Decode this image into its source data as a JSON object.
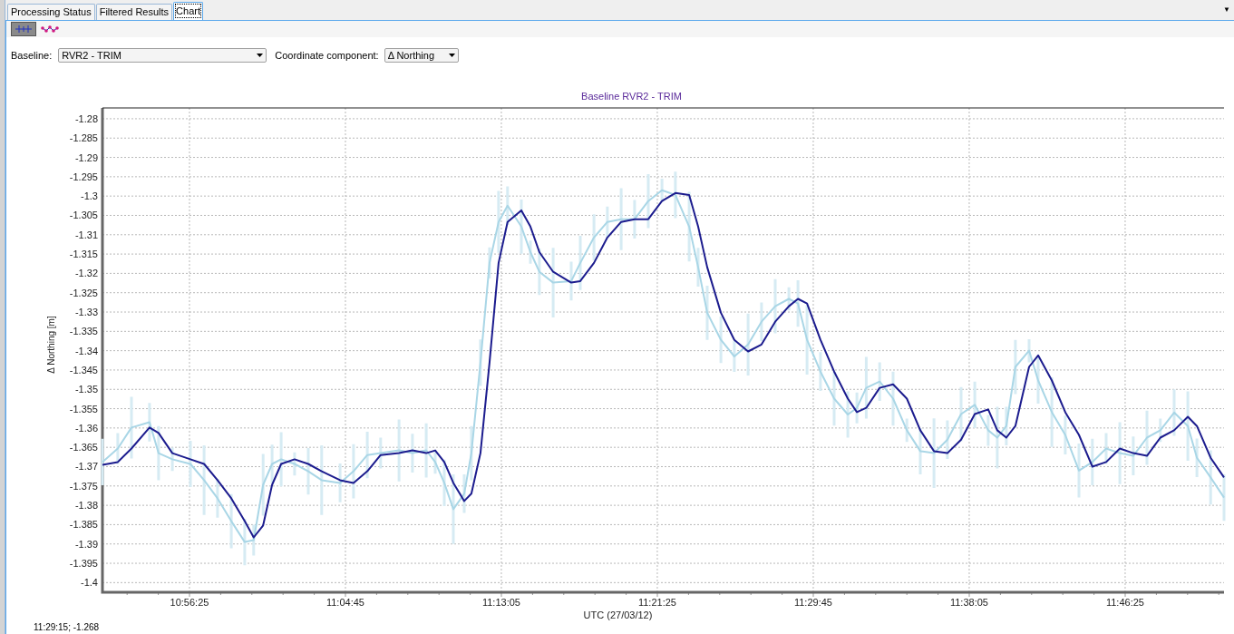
{
  "tabs": [
    {
      "label": "Processing Status",
      "selected": false
    },
    {
      "label": "Filtered Results",
      "selected": false
    },
    {
      "label": "Chart",
      "selected": true
    }
  ],
  "tab_menu": {
    "label": "▼"
  },
  "toolbar": [
    {
      "kind": "error-bars",
      "selected": true
    },
    {
      "kind": "points",
      "selected": false
    }
  ],
  "baseline": {
    "label": "Baseline:",
    "value": "RVR2 - TRIM"
  },
  "component": {
    "label": "Coordinate component:",
    "value": "Δ Northing"
  },
  "chart": {
    "chart_data": {
      "type": "line",
      "title": "Baseline RVR2 - TRIM",
      "xlabel": "UTC (27/03/12)",
      "ylabel": "Δ Northing [m]",
      "x": [
        39106,
        39155,
        39199,
        39257,
        39286,
        39330,
        39388,
        39432,
        39475,
        39519,
        39562,
        39591,
        39621,
        39650,
        39679,
        39722,
        39766,
        39809,
        39868,
        39911,
        39955,
        39998,
        40057,
        40100,
        40144,
        40173,
        40202,
        40231,
        40266,
        40289,
        40318,
        40347,
        40376,
        40405,
        40449,
        40478,
        40507,
        40551,
        40609,
        40638,
        40682,
        40725,
        40769,
        40812,
        40856,
        40900,
        40943,
        40987,
        41016,
        41045,
        41089,
        41132,
        41176,
        41219,
        41263,
        41307,
        41336,
        41365,
        41408,
        41452,
        41496,
        41525,
        41555,
        41598,
        41641,
        41685,
        41728,
        41772,
        41815,
        41859,
        41903,
        41946,
        41975,
        42004,
        42033,
        42077,
        42106,
        42150,
        42193,
        42237,
        42280,
        42324,
        42368,
        42411,
        42455,
        42498,
        42542,
        42586,
        42615,
        42659,
        42702
      ],
      "series": [
        {
          "color": "#1c1c8e",
          "values": [
            -1.3695,
            -1.3688,
            -1.3653,
            -1.3599,
            -1.3613,
            -1.3665,
            -1.3681,
            -1.3693,
            -1.3735,
            -1.3782,
            -1.3841,
            -1.3883,
            -1.3852,
            -1.3747,
            -1.3693,
            -1.3681,
            -1.3693,
            -1.3712,
            -1.3735,
            -1.3742,
            -1.3712,
            -1.367,
            -1.3665,
            -1.3658,
            -1.3665,
            -1.3658,
            -1.3688,
            -1.3742,
            -1.3789,
            -1.377,
            -1.3665,
            -1.3431,
            -1.3173,
            -1.3067,
            -1.3037,
            -1.3079,
            -1.3145,
            -1.3196,
            -1.3224,
            -1.322,
            -1.3173,
            -1.3107,
            -1.3067,
            -1.306,
            -1.306,
            -1.3013,
            -1.2992,
            -1.2997,
            -1.3079,
            -1.3184,
            -1.3302,
            -1.3372,
            -1.3402,
            -1.3384,
            -1.3325,
            -1.3285,
            -1.3266,
            -1.3278,
            -1.3372,
            -1.3454,
            -1.3524,
            -1.3559,
            -1.3548,
            -1.3496,
            -1.3487,
            -1.3524,
            -1.3606,
            -1.366,
            -1.3665,
            -1.363,
            -1.3564,
            -1.3552,
            -1.3606,
            -1.3625,
            -1.3595,
            -1.3442,
            -1.3412,
            -1.3477,
            -1.3559,
            -1.3618,
            -1.37,
            -1.3688,
            -1.3653,
            -1.3665,
            -1.3672,
            -1.3625,
            -1.3606,
            -1.3571,
            -1.3595,
            -1.3677,
            -1.3728
          ]
        },
        {
          "color": "#a9d6e6",
          "values": [
            -1.3688,
            -1.3653,
            -1.3599,
            -1.3585,
            -1.3665,
            -1.3681,
            -1.3693,
            -1.3735,
            -1.3782,
            -1.3841,
            -1.3895,
            -1.389,
            -1.3747,
            -1.3693,
            -1.3681,
            -1.3693,
            -1.3712,
            -1.3735,
            -1.3742,
            -1.3712,
            -1.367,
            -1.3665,
            -1.3658,
            -1.3665,
            -1.3658,
            -1.3688,
            -1.3742,
            -1.381,
            -1.377,
            -1.3665,
            -1.3431,
            -1.3173,
            -1.3067,
            -1.3025,
            -1.3079,
            -1.3145,
            -1.3196,
            -1.3224,
            -1.322,
            -1.3173,
            -1.3107,
            -1.3067,
            -1.306,
            -1.306,
            -1.3013,
            -1.2985,
            -1.2997,
            -1.3079,
            -1.3184,
            -1.3302,
            -1.3372,
            -1.3415,
            -1.3384,
            -1.3325,
            -1.3285,
            -1.3266,
            -1.3278,
            -1.3372,
            -1.3454,
            -1.3524,
            -1.3565,
            -1.3548,
            -1.3496,
            -1.348,
            -1.3524,
            -1.3606,
            -1.366,
            -1.3665,
            -1.363,
            -1.3564,
            -1.354,
            -1.3606,
            -1.3625,
            -1.3595,
            -1.3442,
            -1.34,
            -1.3477,
            -1.3559,
            -1.3618,
            -1.371,
            -1.3688,
            -1.3653,
            -1.3665,
            -1.3672,
            -1.3625,
            -1.3606,
            -1.356,
            -1.3595,
            -1.3677,
            -1.3728,
            -1.378
          ],
          "errors": [
            0.006,
            0.004,
            0.008,
            0.005,
            0.007,
            0.003,
            0.006,
            0.009,
            0.005,
            0.007,
            0.006,
            0.004,
            0.008,
            0.005,
            0.007,
            0.003,
            0.006,
            0.009,
            0.005,
            0.007,
            0.006,
            0.004,
            0.008,
            0.005,
            0.007,
            0.003,
            0.006,
            0.009,
            0.005,
            0.007,
            0.006,
            0.004,
            0.008,
            0.005,
            0.007,
            0.003,
            0.006,
            0.009,
            0.005,
            0.007,
            0.006,
            0.004,
            0.008,
            0.005,
            0.007,
            0.003,
            0.006,
            0.009,
            0.005,
            0.007,
            0.006,
            0.004,
            0.008,
            0.005,
            0.007,
            0.003,
            0.006,
            0.009,
            0.005,
            0.007,
            0.006,
            0.004,
            0.008,
            0.005,
            0.007,
            0.003,
            0.006,
            0.009,
            0.005,
            0.007,
            0.006,
            0.004,
            0.008,
            0.005,
            0.007,
            0.003,
            0.006,
            0.009,
            0.005,
            0.007,
            0.006,
            0.004,
            0.008,
            0.005,
            0.007,
            0.003,
            0.006,
            0.009,
            0.005,
            0.007,
            0.006
          ]
        }
      ],
      "grid": true,
      "xlim": [
        39106,
        42702
      ],
      "ylim": [
        -1.4025,
        -1.2772
      ],
      "xticks": [
        {
          "value": 39385,
          "label": "10:56:25"
        },
        {
          "value": 39885,
          "label": "11:04:45"
        },
        {
          "value": 40385,
          "label": "11:13:05"
        },
        {
          "value": 40885,
          "label": "11:21:25"
        },
        {
          "value": 41385,
          "label": "11:29:45"
        },
        {
          "value": 41885,
          "label": "11:38:05"
        },
        {
          "value": 42385,
          "label": "11:46:25"
        }
      ],
      "yticks": [
        {
          "value": -1.28,
          "label": "-1.28"
        },
        {
          "value": -1.285,
          "label": "-1.285"
        },
        {
          "value": -1.29,
          "label": "-1.29"
        },
        {
          "value": -1.295,
          "label": "-1.295"
        },
        {
          "value": -1.3,
          "label": "-1.3"
        },
        {
          "value": -1.305,
          "label": "-1.305"
        },
        {
          "value": -1.31,
          "label": "-1.31"
        },
        {
          "value": -1.315,
          "label": "-1.315"
        },
        {
          "value": -1.32,
          "label": "-1.32"
        },
        {
          "value": -1.325,
          "label": "-1.325"
        },
        {
          "value": -1.33,
          "label": "-1.33"
        },
        {
          "value": -1.335,
          "label": "-1.335"
        },
        {
          "value": -1.34,
          "label": "-1.34"
        },
        {
          "value": -1.345,
          "label": "-1.345"
        },
        {
          "value": -1.35,
          "label": "-1.35"
        },
        {
          "value": -1.355,
          "label": "-1.355"
        },
        {
          "value": -1.36,
          "label": "-1.36"
        },
        {
          "value": -1.365,
          "label": "-1.365"
        },
        {
          "value": -1.37,
          "label": "-1.37"
        },
        {
          "value": -1.375,
          "label": "-1.375"
        },
        {
          "value": -1.38,
          "label": "-1.38"
        },
        {
          "value": -1.385,
          "label": "-1.385"
        },
        {
          "value": -1.39,
          "label": "-1.39"
        },
        {
          "value": -1.395,
          "label": "-1.395"
        },
        {
          "value": -1.4,
          "label": "-1.4"
        }
      ]
    }
  },
  "status": {
    "text": "11:29:15; -1.268"
  }
}
